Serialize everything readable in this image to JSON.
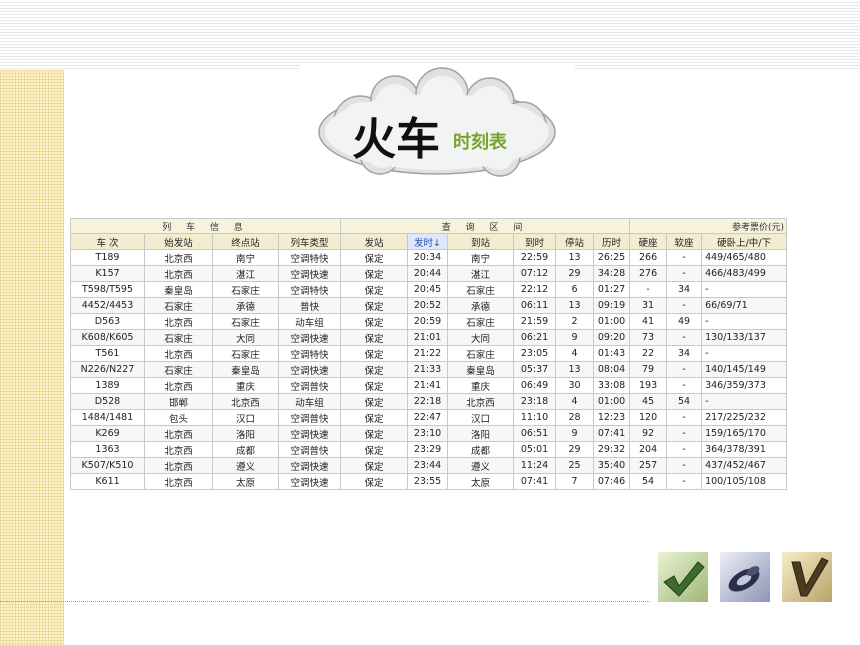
{
  "banner": {
    "title": "火车",
    "subtitle": "时刻表"
  },
  "table": {
    "groups": [
      "列 车 信 息",
      "查 询 区 间",
      "参考票价(元)"
    ],
    "headers": [
      "车 次",
      "始发站",
      "终点站",
      "列车类型",
      "发站",
      "发时↓",
      "到站",
      "到时",
      "停站",
      "历时",
      "硬座",
      "软座",
      "硬卧上/中/下"
    ],
    "rows": [
      [
        "T189",
        "北京西",
        "南宁",
        "空调特快",
        "保定",
        "20:34",
        "南宁",
        "22:59",
        "13",
        "26:25",
        "266",
        "-",
        "449/465/480"
      ],
      [
        "K157",
        "北京西",
        "湛江",
        "空调快速",
        "保定",
        "20:44",
        "湛江",
        "07:12",
        "29",
        "34:28",
        "276",
        "-",
        "466/483/499"
      ],
      [
        "T598/T595",
        "秦皇岛",
        "石家庄",
        "空调特快",
        "保定",
        "20:45",
        "石家庄",
        "22:12",
        "6",
        "01:27",
        "-",
        "34",
        "-"
      ],
      [
        "4452/4453",
        "石家庄",
        "承德",
        "普快",
        "保定",
        "20:52",
        "承德",
        "06:11",
        "13",
        "09:19",
        "31",
        "-",
        "66/69/71"
      ],
      [
        "D563",
        "北京西",
        "石家庄",
        "动车组",
        "保定",
        "20:59",
        "石家庄",
        "21:59",
        "2",
        "01:00",
        "41",
        "49",
        "-"
      ],
      [
        "K608/K605",
        "石家庄",
        "大同",
        "空调快速",
        "保定",
        "21:01",
        "大同",
        "06:21",
        "9",
        "09:20",
        "73",
        "-",
        "130/133/137"
      ],
      [
        "T561",
        "北京西",
        "石家庄",
        "空调特快",
        "保定",
        "21:22",
        "石家庄",
        "23:05",
        "4",
        "01:43",
        "22",
        "34",
        "-"
      ],
      [
        "N226/N227",
        "石家庄",
        "秦皇岛",
        "空调快速",
        "保定",
        "21:33",
        "秦皇岛",
        "05:37",
        "13",
        "08:04",
        "79",
        "-",
        "140/145/149"
      ],
      [
        "1389",
        "北京西",
        "重庆",
        "空调普快",
        "保定",
        "21:41",
        "重庆",
        "06:49",
        "30",
        "33:08",
        "193",
        "-",
        "346/359/373"
      ],
      [
        "D528",
        "邯郸",
        "北京西",
        "动车组",
        "保定",
        "22:18",
        "北京西",
        "23:18",
        "4",
        "01:00",
        "45",
        "54",
        "-"
      ],
      [
        "1484/1481",
        "包头",
        "汉口",
        "空调普快",
        "保定",
        "22:47",
        "汉口",
        "11:10",
        "28",
        "12:23",
        "120",
        "-",
        "217/225/232"
      ],
      [
        "K269",
        "北京西",
        "洛阳",
        "空调快速",
        "保定",
        "23:10",
        "洛阳",
        "06:51",
        "9",
        "07:41",
        "92",
        "-",
        "159/165/170"
      ],
      [
        "1363",
        "北京西",
        "成都",
        "空调普快",
        "保定",
        "23:29",
        "成都",
        "05:01",
        "29",
        "29:32",
        "204",
        "-",
        "364/378/391"
      ],
      [
        "K507/K510",
        "北京西",
        "遵义",
        "空调快速",
        "保定",
        "23:44",
        "遵义",
        "11:24",
        "25",
        "35:40",
        "257",
        "-",
        "437/452/467"
      ],
      [
        "K611",
        "北京西",
        "太原",
        "空调快速",
        "保定",
        "23:55",
        "太原",
        "07:41",
        "7",
        "07:46",
        "54",
        "-",
        "100/105/108"
      ]
    ]
  },
  "decor": {
    "icons": [
      "green-checkmark-icon",
      "chrome-disc-icon",
      "bronze-checkmark-icon"
    ]
  }
}
